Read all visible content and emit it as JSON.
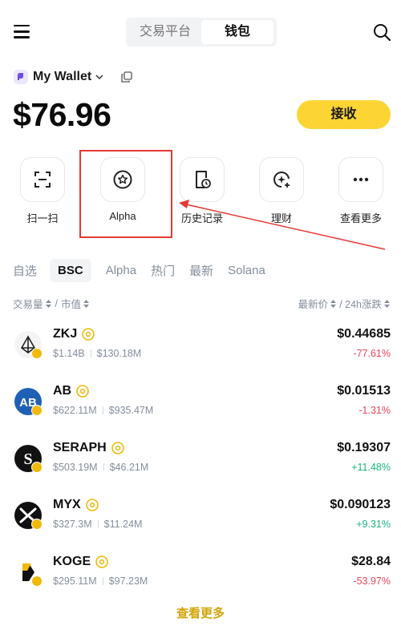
{
  "header": {
    "tabs": [
      {
        "label": "交易平台"
      },
      {
        "label": "钱包"
      }
    ]
  },
  "wallet": {
    "name": "My Wallet",
    "balance": "$76.96",
    "receive_label": "接收"
  },
  "actions": [
    {
      "label": "扫一扫",
      "icon": "scan-icon"
    },
    {
      "label": "Alpha",
      "icon": "star-circle-icon"
    },
    {
      "label": "历史记录",
      "icon": "history-icon"
    },
    {
      "label": "理财",
      "icon": "earn-icon"
    },
    {
      "label": "查看更多",
      "icon": "more-icon"
    }
  ],
  "categories": [
    "自选",
    "BSC",
    "Alpha",
    "热门",
    "最新",
    "Solana"
  ],
  "active_category": "BSC",
  "sort": {
    "left_a": "交易量",
    "left_b": "市值",
    "right_a": "最新价",
    "right_b": "/ 24h涨跌"
  },
  "tokens": [
    {
      "symbol": "ZKJ",
      "volume": "$1.14B",
      "mcap": "$130.18M",
      "price": "$0.44685",
      "change": "-77.61%",
      "direction": "down"
    },
    {
      "symbol": "AB",
      "volume": "$622.11M",
      "mcap": "$935.47M",
      "price": "$0.01513",
      "change": "-1.31%",
      "direction": "down"
    },
    {
      "symbol": "SERAPH",
      "volume": "$503.19M",
      "mcap": "$46.21M",
      "price": "$0.19307",
      "change": "+11.48%",
      "direction": "up"
    },
    {
      "symbol": "MYX",
      "volume": "$327.3M",
      "mcap": "$11.24M",
      "price": "$0.090123",
      "change": "+9.31%",
      "direction": "up"
    },
    {
      "symbol": "KOGE",
      "volume": "$295.11M",
      "mcap": "$97.23M",
      "price": "$28.84",
      "change": "-53.97%",
      "direction": "down"
    }
  ],
  "see_more": "查看更多",
  "colors": {
    "accent_yellow": "#fcd535",
    "negative": "#e8455a",
    "positive": "#16b77b",
    "highlight_red": "#e53935"
  }
}
